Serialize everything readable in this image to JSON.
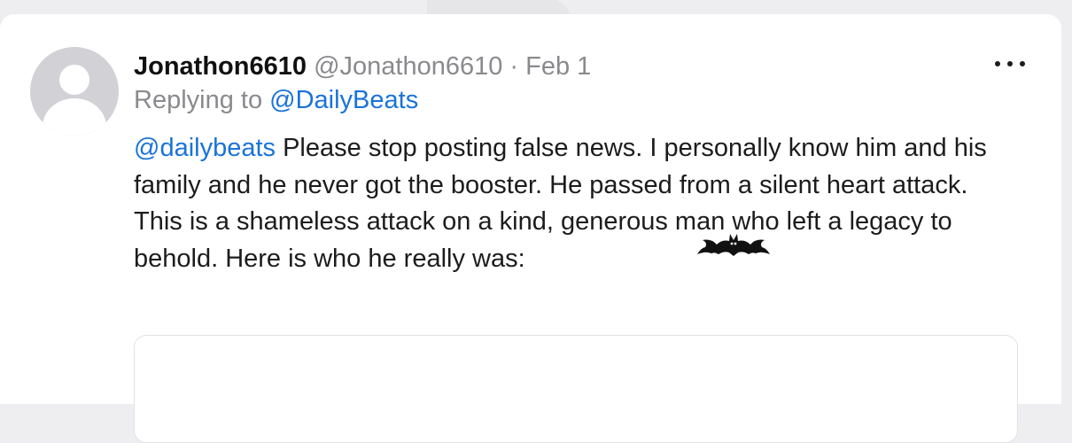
{
  "post": {
    "display_name": "Jonathon6610",
    "handle": "@Jonathon6610",
    "separator": "·",
    "date": "Feb 1",
    "replying_prefix": "Replying to",
    "replying_to": "@DailyBeats",
    "mention": "@dailybeats",
    "text": "Please stop posting false news. I personally know him and his family and he never got the booster. He passed from a silent heart attack. This is a shameless attack on a kind, generous man who left a legacy to behold. Here is who he really was:"
  },
  "icons": {
    "avatar": "default-avatar-icon",
    "more": "more-options-icon",
    "sticker": "bat-sticker"
  },
  "colors": {
    "link": "#1a73d9",
    "secondary_text": "#8a8a8e",
    "avatar_bg": "#d1d1d6",
    "page_bg": "#eeeef0"
  }
}
